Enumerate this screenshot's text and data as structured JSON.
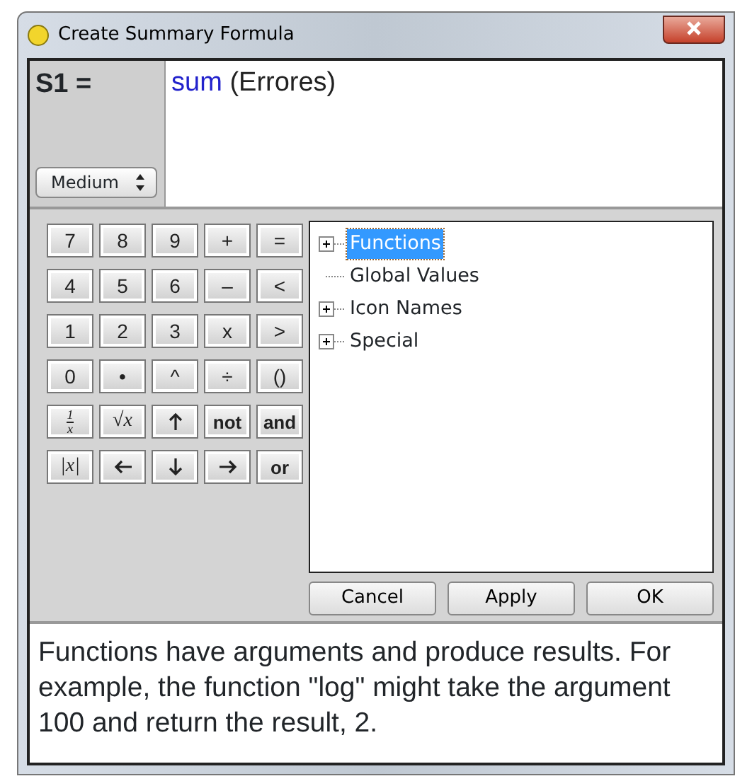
{
  "window": {
    "title": "Create Summary Formula"
  },
  "formula": {
    "label": "S1 =",
    "size": "Medium",
    "tokens": [
      {
        "text": "sum",
        "kind": "function"
      },
      {
        "text": "(Errores)",
        "kind": "argument"
      }
    ]
  },
  "keypad": [
    [
      {
        "text": "7",
        "kind": "text"
      },
      {
        "text": "8",
        "kind": "text"
      },
      {
        "text": "9",
        "kind": "text"
      },
      {
        "text": "+",
        "kind": "text"
      },
      {
        "text": "=",
        "kind": "text"
      }
    ],
    [
      {
        "text": "4",
        "kind": "text"
      },
      {
        "text": "5",
        "kind": "text"
      },
      {
        "text": "6",
        "kind": "text"
      },
      {
        "text": "–",
        "kind": "text"
      },
      {
        "text": "<",
        "kind": "text"
      }
    ],
    [
      {
        "text": "1",
        "kind": "text"
      },
      {
        "text": "2",
        "kind": "text"
      },
      {
        "text": "3",
        "kind": "text"
      },
      {
        "text": "x",
        "kind": "text"
      },
      {
        "text": ">",
        "kind": "text"
      }
    ],
    [
      {
        "text": "0",
        "kind": "text"
      },
      {
        "text": "•",
        "kind": "text"
      },
      {
        "text": "^",
        "kind": "text"
      },
      {
        "text": "÷",
        "kind": "text"
      },
      {
        "text": "()",
        "kind": "text"
      }
    ],
    [
      {
        "num": "1",
        "den": "x",
        "kind": "fraction"
      },
      {
        "text": "√x",
        "kind": "math"
      },
      {
        "kind": "arrow-up"
      },
      {
        "text": "not",
        "kind": "text"
      },
      {
        "text": "and",
        "kind": "text"
      }
    ],
    [
      {
        "text": "|x|",
        "kind": "math"
      },
      {
        "kind": "arrow-left"
      },
      {
        "kind": "arrow-down"
      },
      {
        "kind": "arrow-right"
      },
      {
        "text": "or",
        "kind": "text"
      }
    ]
  ],
  "tree": [
    {
      "label": "Functions",
      "kind": "folder",
      "selected": true
    },
    {
      "label": "Global Values",
      "kind": "leaf",
      "selected": false
    },
    {
      "label": "Icon Names",
      "kind": "folder",
      "selected": false
    },
    {
      "label": "Special",
      "kind": "folder",
      "selected": false
    }
  ],
  "buttons": [
    "Cancel",
    "Apply",
    "OK"
  ],
  "help": "Functions have arguments and produce results. For example, the function \"log\" might take the argument 100 and return the result, 2."
}
